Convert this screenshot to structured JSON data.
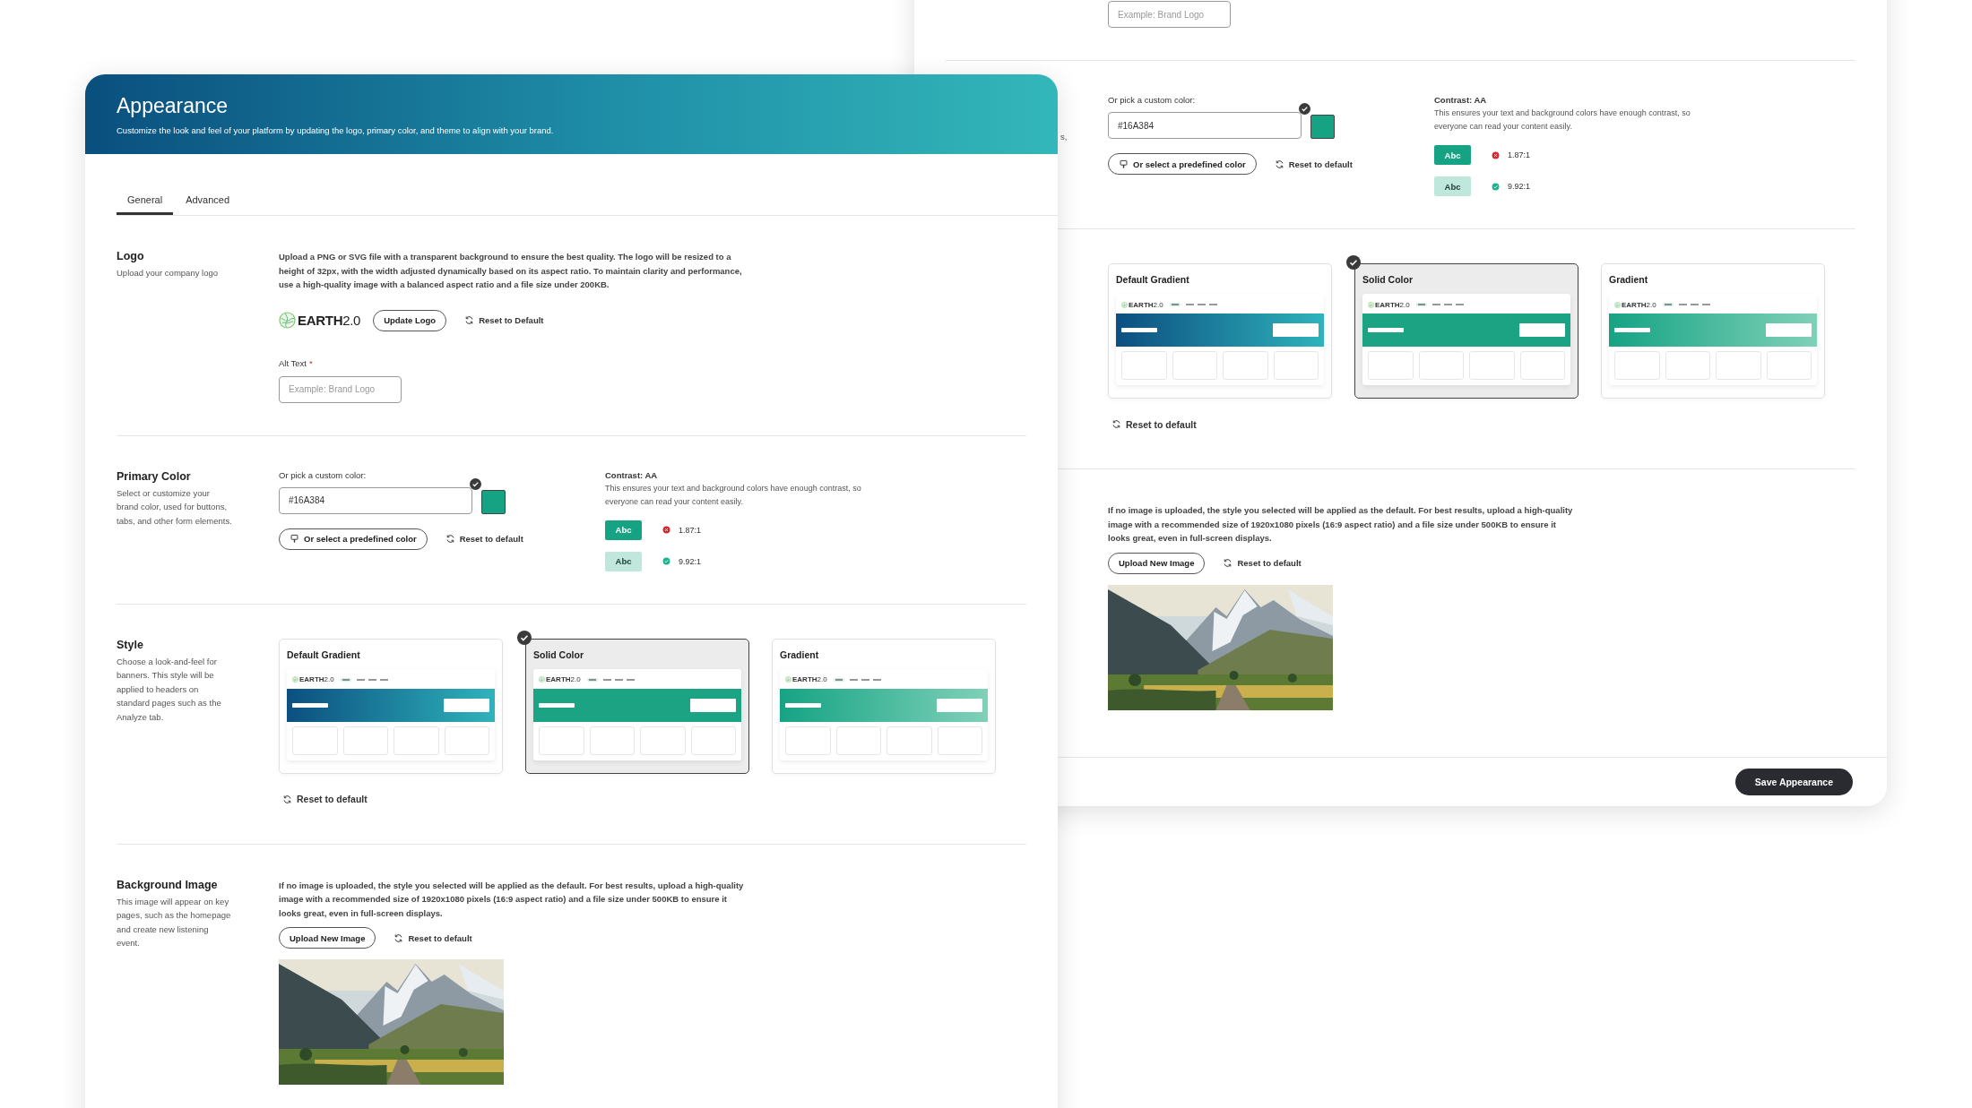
{
  "back": {
    "alt_field": {
      "placeholder": "Example: Brand Logo"
    },
    "color_section": {
      "subtitle_fragment": "s,",
      "custom_label": "Or pick a custom color:",
      "color_field": {
        "value": "#16A384"
      },
      "swatch_selected": true,
      "predefined_button": "Or select a predefined color",
      "reset_button": "Reset to default",
      "contrast_title": "Contrast: AA",
      "contrast_description": "This ensures your text and background colors have enough contrast, so everyone can read your content easily.",
      "samples": [
        {
          "label": "Abc",
          "kind": "solid",
          "pass": false,
          "ratio": "1.87:1"
        },
        {
          "label": "Abc",
          "kind": "light",
          "pass": true,
          "ratio": "9.92:1"
        }
      ]
    },
    "style_section": {
      "options": [
        {
          "title": "Default Gradient",
          "kind": "default_gradient",
          "selected": false,
          "preview_logo": "**EARTH**2.0"
        },
        {
          "title": "Solid Color",
          "kind": "solid",
          "selected": true,
          "preview_logo": "**EARTH**2.0"
        },
        {
          "title": "Gradient",
          "kind": "gradient",
          "selected": false,
          "preview_logo": "**EARTH**2.0"
        }
      ],
      "reset_button": "Reset to default"
    },
    "background_section": {
      "description": "If no image is uploaded, the style you selected will be applied as the default. For best results, upload a high-quality image with a recommended size of 1920x1080 pixels (16:9 aspect ratio) and a file size under 500KB to ensure it looks great, even in full-screen displays.",
      "upload_button": "Upload New Image",
      "reset_button": "Reset to default"
    },
    "save_button": "Save Appearance"
  },
  "front": {
    "header": {
      "title": "Appearance",
      "subtitle": "Customize the look and feel of your platform by updating the logo, primary color, and theme to align with your brand."
    },
    "tabs": [
      {
        "label": "General",
        "selected": true
      },
      {
        "label": "Advanced",
        "selected": false
      }
    ],
    "logo_section": {
      "title": "Logo",
      "subtitle": "Upload your company logo",
      "description": "Upload a PNG or SVG file with a transparent background to ensure the best quality. The logo will be resized to a height of 32px, with the width adjusted dynamically based on its aspect ratio. To maintain clarity and performance, use a high-quality image with a balanced aspect ratio and a file size under 200KB.",
      "logo_text": "**EARTH**2.0",
      "update_button": "Update Logo",
      "reset_button": "Reset to Default",
      "alt_label": "Alt Text",
      "required_mark": "*",
      "alt_field": {
        "placeholder": "Example: Brand Logo"
      }
    },
    "color_section": {
      "title": "Primary Color",
      "subtitle": "Select or customize your brand color, used for buttons, tabs, and other form elements.",
      "custom_label": "Or pick a custom color:",
      "color_field": {
        "value": "#16A384"
      },
      "swatch_selected": true,
      "predefined_button": "Or select a predefined color",
      "reset_button": "Reset to default",
      "contrast_title": "Contrast: AA",
      "contrast_description": "This ensures your text and background colors have enough contrast, so everyone can read your content easily.",
      "samples": [
        {
          "label": "Abc",
          "kind": "solid",
          "pass": false,
          "ratio": "1.87:1"
        },
        {
          "label": "Abc",
          "kind": "light",
          "pass": true,
          "ratio": "9.92:1"
        }
      ]
    },
    "style_section": {
      "title": "Style",
      "subtitle": "Choose a look-and-feel for banners. This style will be applied to headers on standard pages such as the Analyze tab.",
      "options": [
        {
          "title": "Default Gradient",
          "kind": "default_gradient",
          "selected": false,
          "preview_logo": "**EARTH**2.0"
        },
        {
          "title": "Solid Color",
          "kind": "solid",
          "selected": true,
          "preview_logo": "**EARTH**2.0"
        },
        {
          "title": "Gradient",
          "kind": "gradient",
          "selected": false,
          "preview_logo": "**EARTH**2.0"
        }
      ],
      "reset_button": "Reset to default"
    },
    "background_section": {
      "title": "Background Image",
      "subtitle": "This image will appear on key pages, such as the homepage and create new listening event.",
      "description": "If no image is uploaded, the style you selected will be applied as the default. For best results, upload a high-quality image with a recommended size of 1920x1080 pixels (16:9 aspect ratio) and a file size under 500KB to ensure it looks great, even in full-screen displays.",
      "upload_button": "Upload New Image",
      "reset_button": "Reset to default"
    }
  }
}
